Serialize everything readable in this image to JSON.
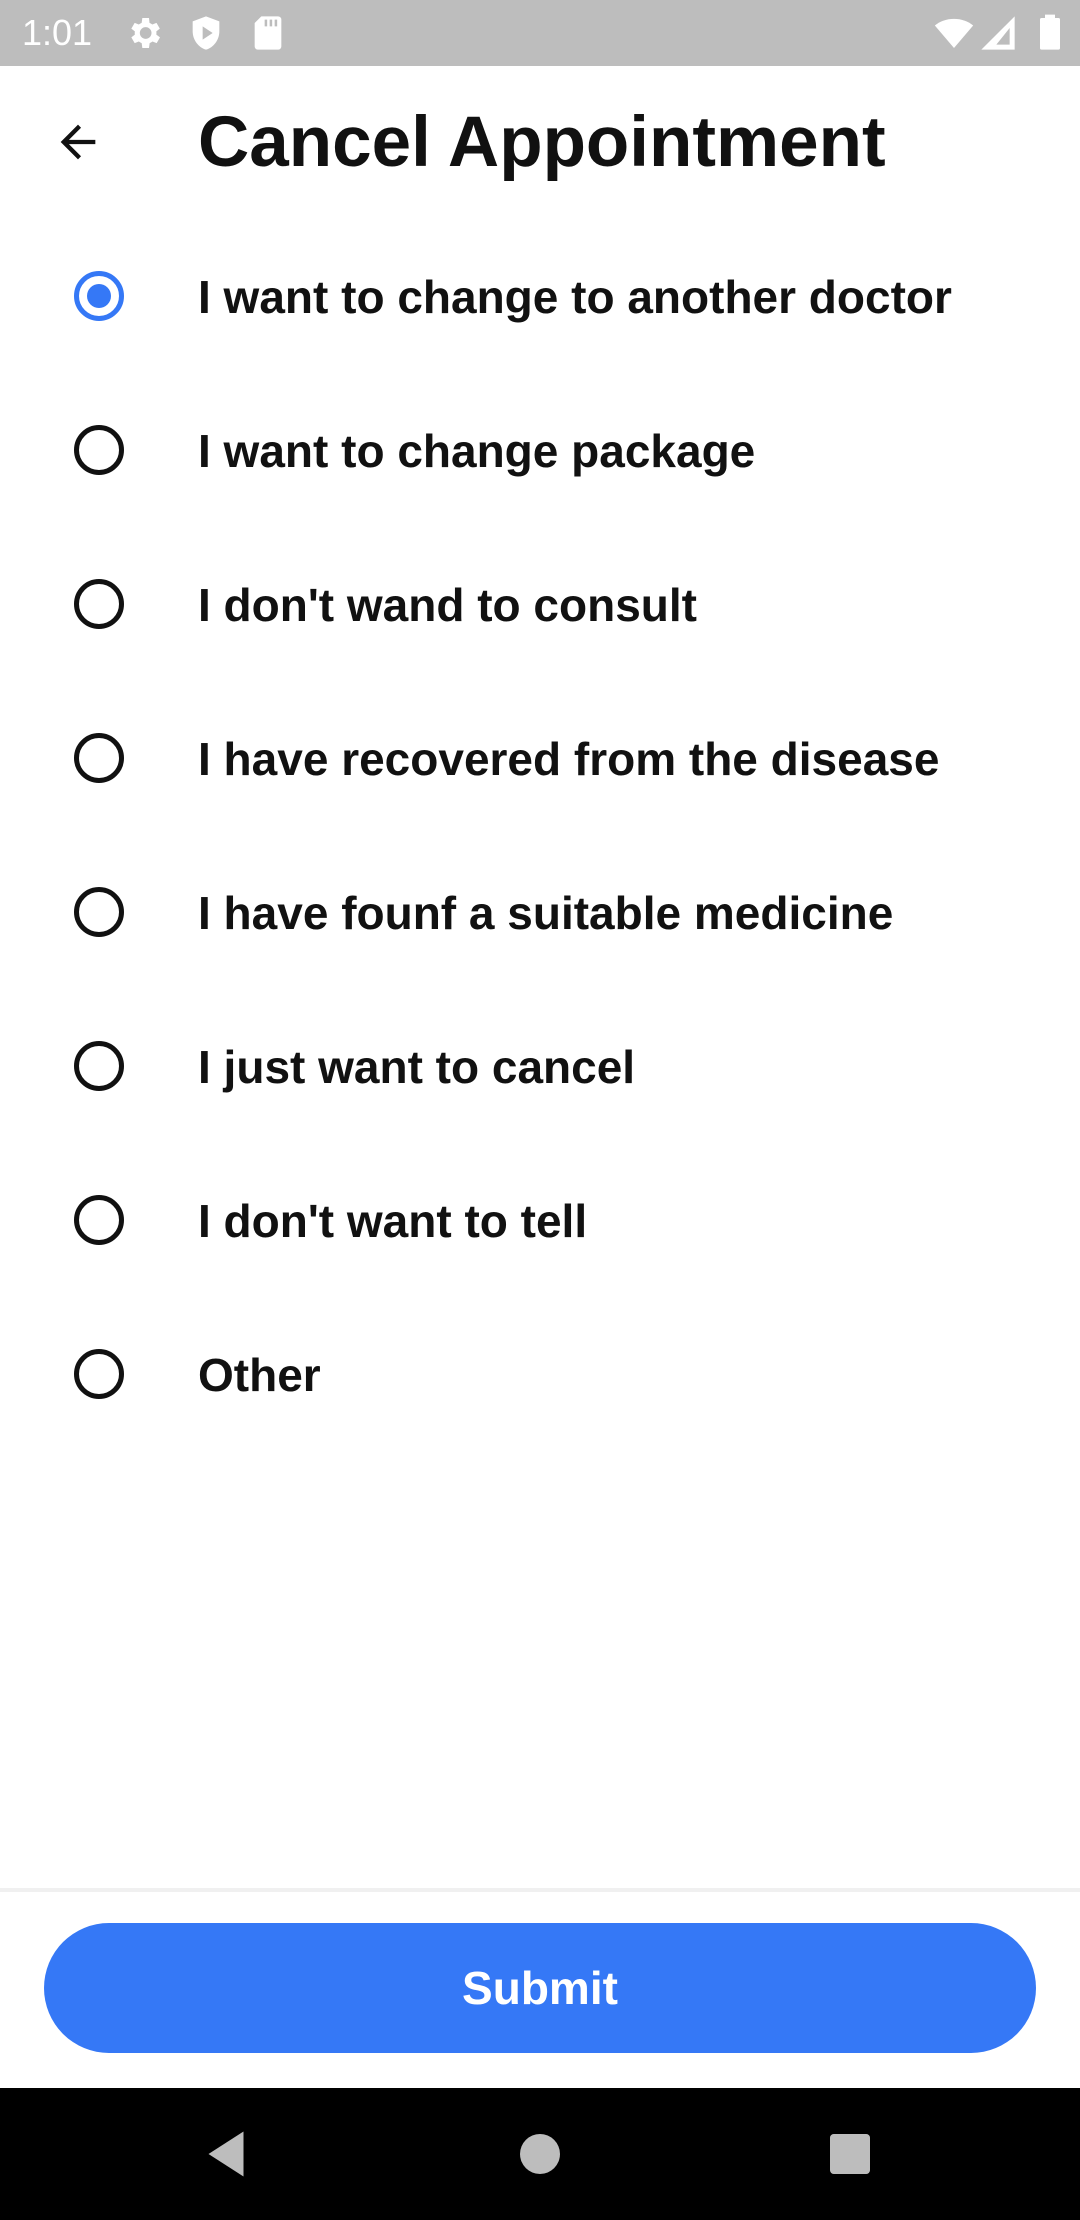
{
  "status_bar": {
    "time": "1:01",
    "icons": [
      "settings-icon",
      "shield-play-icon",
      "sd-card-icon",
      "wifi-icon",
      "signal-icon",
      "battery-icon"
    ]
  },
  "header": {
    "back_icon": "arrow-left-icon",
    "title": "Cancel Appointment"
  },
  "options": [
    {
      "label": "I want to change to another doctor",
      "selected": true
    },
    {
      "label": "I want to change package",
      "selected": false
    },
    {
      "label": "I don't wand to consult",
      "selected": false
    },
    {
      "label": "I have recovered from the disease",
      "selected": false
    },
    {
      "label": "I have founf a suitable medicine",
      "selected": false
    },
    {
      "label": "I just want to cancel",
      "selected": false
    },
    {
      "label": "I don't want to tell",
      "selected": false
    },
    {
      "label": "Other",
      "selected": false
    }
  ],
  "footer": {
    "submit_label": "Submit"
  },
  "nav_bar": {
    "icons": [
      "back-triangle-icon",
      "home-circle-icon",
      "recents-square-icon"
    ]
  },
  "colors": {
    "accent": "#3578f6",
    "status_bar": "#bdbdbd",
    "nav_bar": "#000000",
    "text": "#111111"
  }
}
